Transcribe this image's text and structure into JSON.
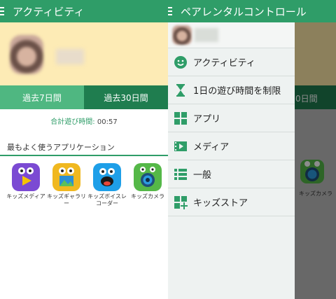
{
  "left": {
    "appbar_title": "アクティビティ",
    "tabs": [
      {
        "label": "過去7日間",
        "active": true
      },
      {
        "label": "過去30日間",
        "active": false
      }
    ],
    "total_label": "合計遊び時間:",
    "total_time": "00:57",
    "section_title": "最もよく使うアプリケーション",
    "apps": [
      {
        "label": "キッズメディア",
        "icon": "kids-media-icon"
      },
      {
        "label": "キッズギャラリー",
        "icon": "kids-gallery-icon"
      },
      {
        "label": "キッズボイスレコーダー",
        "icon": "kids-voice-recorder-icon"
      },
      {
        "label": "キッズカメラ",
        "icon": "kids-camera-icon"
      }
    ]
  },
  "right": {
    "appbar_title": "ペアレンタルコントロール",
    "bg_tab_label": "0日間",
    "bg_camera_label": "キッズカメラ",
    "drawer_items": [
      {
        "label": "アクティビティ",
        "icon": "activity-icon"
      },
      {
        "label": "1日の遊び時間を制限",
        "icon": "hourglass-icon"
      },
      {
        "label": "アプリ",
        "icon": "apps-grid-icon"
      },
      {
        "label": "メディア",
        "icon": "media-film-icon"
      },
      {
        "label": "一般",
        "icon": "list-icon"
      },
      {
        "label": "キッズストア",
        "icon": "store-add-icon"
      }
    ]
  },
  "colors": {
    "primary": "#2f9d68",
    "primary_dark": "#1f7d4f",
    "tab_active": "#4fb781",
    "profile_bg": "#fdebb5"
  }
}
